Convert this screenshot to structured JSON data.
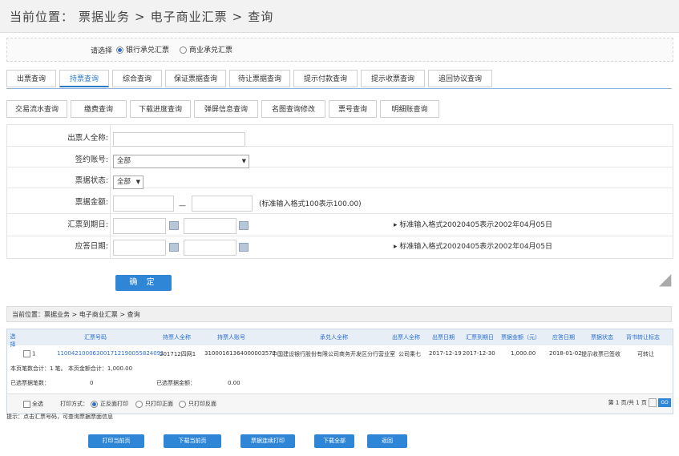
{
  "header": {
    "breadcrumb": [
      "当前位置：",
      "票据业务",
      ">",
      "电子商业汇票",
      ">",
      "查询"
    ]
  },
  "bill_type": {
    "label": "请选择",
    "options": [
      {
        "label": "银行承兑汇票",
        "selected": true
      },
      {
        "label": "商业承兑汇票",
        "selected": false
      }
    ]
  },
  "main_tabs": [
    {
      "label": "出票查询",
      "active": false
    },
    {
      "label": "持票查询",
      "active": true
    },
    {
      "label": "综合查询",
      "active": false
    },
    {
      "label": "保证票据查询",
      "active": false
    },
    {
      "label": "待让票据查询",
      "active": false
    },
    {
      "label": "提示付款查询",
      "active": false
    },
    {
      "label": "提示收票查询",
      "active": false
    },
    {
      "label": "追回协议查询",
      "active": false
    }
  ],
  "sub_tabs": [
    {
      "label": "交易流水查询"
    },
    {
      "label": "缴费查询"
    },
    {
      "label": "下载进度查询"
    },
    {
      "label": "弹屏信息查询"
    },
    {
      "label": "名图查询修改"
    },
    {
      "label": "票号查询"
    },
    {
      "label": "明细账查询"
    }
  ],
  "form": {
    "drawer_name_label": "出票人全称:",
    "account_label": "签约账号:",
    "account_value": "全部",
    "status_label": "票据状态:",
    "status_value": "全部",
    "amount_label": "票据金额:",
    "amount_hint": "(标准输入格式100表示100.00)",
    "due_date_label": "汇票到期日:",
    "due_date_hint": "标准输入格式20020405表示2002年04月05日",
    "reply_date_label": "应答日期:",
    "reply_date_hint": "标准输入格式20020405表示2002年04月05日",
    "confirm_label": "确 定"
  },
  "result": {
    "breadcrumb": "当前位置：票据业务 > 电子商业汇票 > 查询",
    "columns": [
      "选择",
      "汇票号码",
      "持票人全称",
      "持票人账号",
      "承兑人全称",
      "出票人全称",
      "出票日期",
      "汇票到期日",
      "票据金额（元）",
      "应答日期",
      "票据状态",
      "背书转让标志"
    ],
    "row": {
      "index": "1",
      "bill_no": "110042100063001712190055824091",
      "holder_name": "201712四网1",
      "holder_account": "31000161364000003577",
      "acceptor": "中国建设银行股份有限公司商务开发区分行营业室",
      "drawer": "公司乘七",
      "issue_date": "2017-12-19",
      "due_date": "2017-12-30",
      "amount": "1,000.00",
      "reply_date": "2018-01-02",
      "status": "提示收票已签收",
      "endorse_flag": "可转让"
    },
    "page_total_label": "本页笔数合计：1 笔。 本页金额合计：1,000.00",
    "selected_count_label": "已选票据笔数：",
    "selected_count": "0",
    "selected_amount_label": "已选票据金额：",
    "selected_amount": "0.00",
    "select_all": "全选",
    "print_mode_label": "打印方式：",
    "print_modes": [
      {
        "label": "正反面打印",
        "selected": true
      },
      {
        "label": "只打印正面",
        "selected": false
      },
      {
        "label": "只打印反面",
        "selected": false
      }
    ],
    "pager_text": "第 1 页/共 1 页",
    "pager_go": "GO",
    "tip": "提示：点击汇票号码，可查询票据票面信息"
  },
  "buttons": [
    "打印当前页",
    "下载当前页",
    "票据连续打印",
    "下载全部",
    "返回"
  ]
}
